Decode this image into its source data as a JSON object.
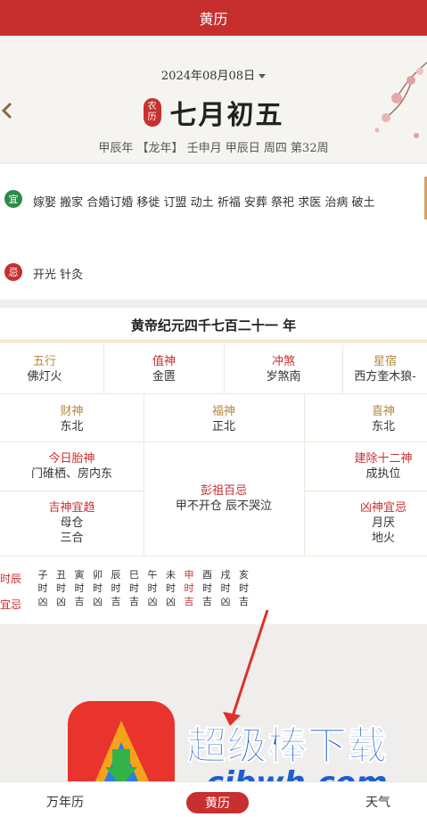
{
  "header": {
    "title": "黄历"
  },
  "date_card": {
    "date_selector": "2024年08月08日",
    "nongli_badge": [
      "农",
      "历"
    ],
    "lunar_date": "七月初五",
    "ganzhi": "甲辰年 【龙年】 壬申月 甲辰日 周四 第32周"
  },
  "yiji": {
    "yi_badge": "宜",
    "yi_text": "嫁娶 搬家 合婚订婚 移徙 订盟 动土 祈福 安葬 祭祀 求医 治病 破土",
    "ji_badge": "忌",
    "ji_text": "开光 针灸"
  },
  "huangdi": {
    "title": "黄帝纪元四千七百二十一 年",
    "row1": [
      {
        "label": "五行",
        "value": "佛灯火",
        "color": "#b5883e"
      },
      {
        "label": "值神",
        "value": "金匮",
        "color": "#c7302f"
      },
      {
        "label": "冲煞",
        "value": "岁煞南",
        "color": "#c7302f"
      },
      {
        "label": "星宿",
        "value": "西方奎木狼-",
        "color": "#b5883e"
      }
    ],
    "caishen": {
      "label": "财神",
      "value": "东北"
    },
    "fushen": {
      "label": "福神",
      "value": "正北"
    },
    "xishen": {
      "label": "喜神",
      "value": "东北"
    },
    "taishen": {
      "label": "今日胎神",
      "value": "门碓栖、房内东"
    },
    "jianchu": {
      "label": "建除十二神",
      "value": "成执位"
    },
    "pengzu": {
      "label": "彭祖百忌",
      "value": "甲不开仓 辰不哭泣"
    },
    "jishen": {
      "label": "吉神宜趋",
      "values": [
        "母仓",
        "三合"
      ]
    },
    "xiongshen": {
      "label": "凶神宜忌",
      "values": [
        "月厌",
        "地火"
      ]
    }
  },
  "hours": {
    "label_shichen": "时辰",
    "label_yiji": "宜忌",
    "columns": [
      {
        "branch": "子",
        "shi": "时",
        "luck": "凶"
      },
      {
        "branch": "丑",
        "shi": "时",
        "luck": "凶"
      },
      {
        "branch": "寅",
        "shi": "时",
        "luck": "吉"
      },
      {
        "branch": "卯",
        "shi": "时",
        "luck": "凶"
      },
      {
        "branch": "辰",
        "shi": "时",
        "luck": "吉"
      },
      {
        "branch": "巳",
        "shi": "时",
        "luck": "吉"
      },
      {
        "branch": "午",
        "shi": "时",
        "luck": "凶"
      },
      {
        "branch": "未",
        "shi": "时",
        "luck": "凶"
      },
      {
        "branch": "申",
        "shi": "时",
        "luck": "吉"
      },
      {
        "branch": "酉",
        "shi": "时",
        "luck": "吉"
      },
      {
        "branch": "戌",
        "shi": "时",
        "luck": "凶"
      },
      {
        "branch": "亥",
        "shi": "时",
        "luck": "吉"
      }
    ],
    "active_index": 8
  },
  "watermark": {
    "text": "超级棒下载站",
    "url": ".cjbwh.com"
  },
  "bottom_nav": {
    "left": "万年历",
    "active": "黄历",
    "right": "天气"
  },
  "colors": {
    "primary_red": "#c62f2e",
    "gold": "#b5883e",
    "green": "#2d8a4a"
  }
}
